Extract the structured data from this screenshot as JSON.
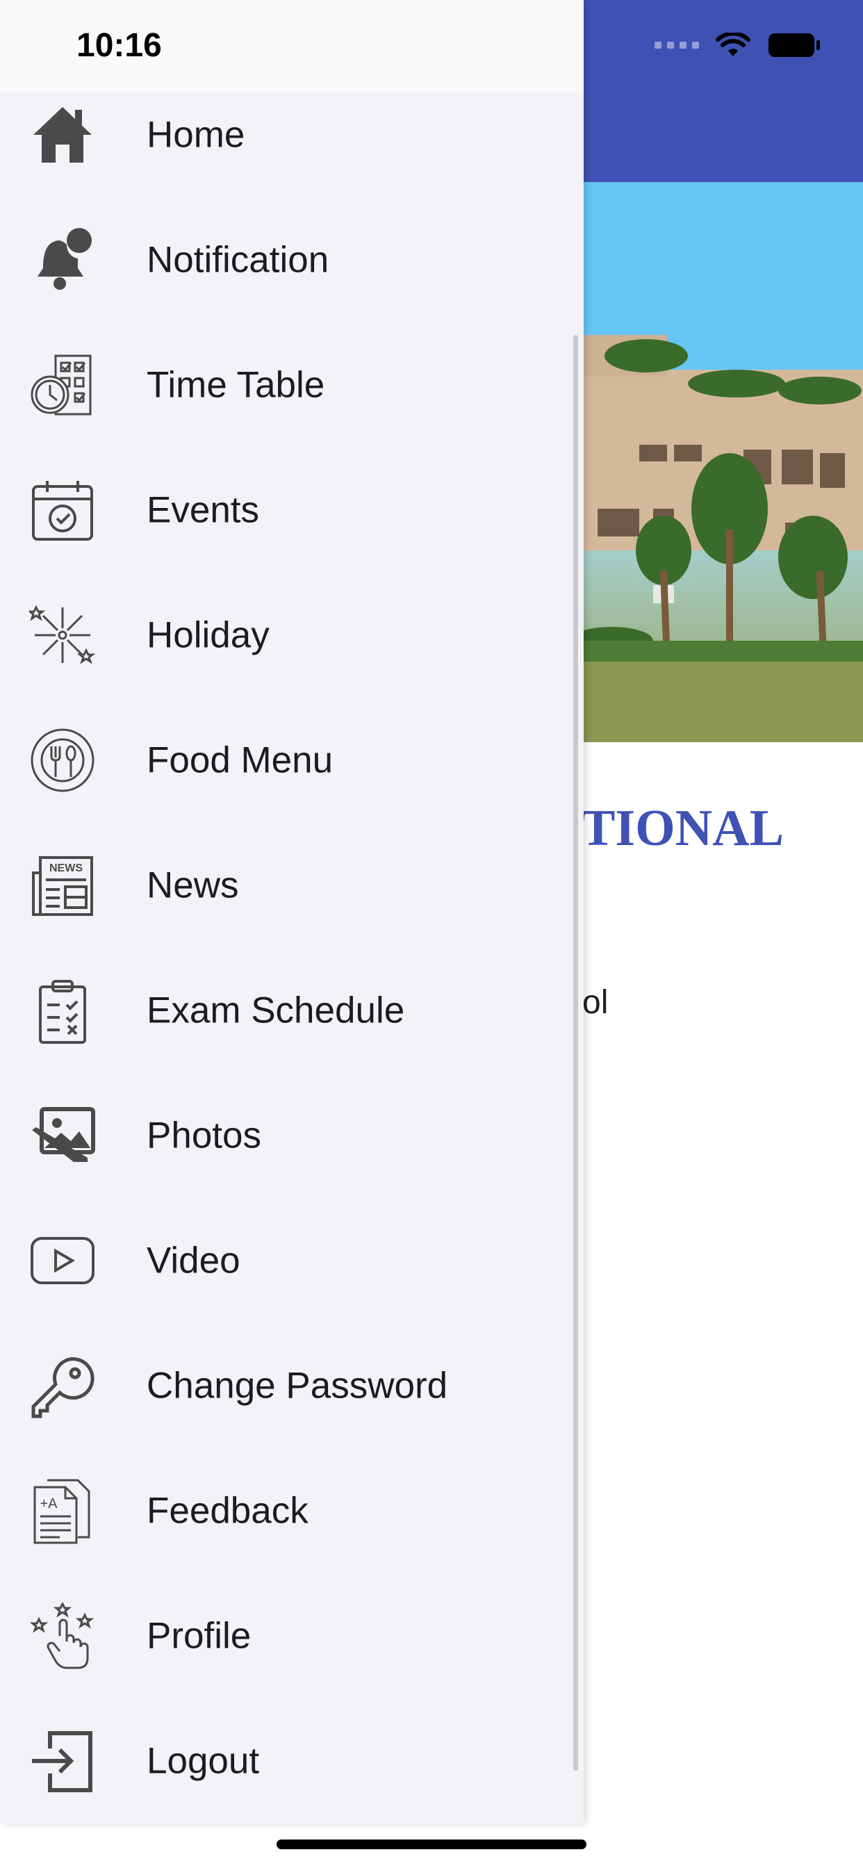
{
  "status_bar": {
    "time": "10:16"
  },
  "background": {
    "title_fragment": "TIONAL",
    "subtitle_fragment": "ol",
    "accent_color": "#3f51b5"
  },
  "drawer": {
    "items": [
      {
        "label": "Home",
        "icon": "home-icon"
      },
      {
        "label": "Notification",
        "icon": "bell-icon"
      },
      {
        "label": "Time Table",
        "icon": "timetable-icon"
      },
      {
        "label": "Events",
        "icon": "calendar-icon"
      },
      {
        "label": "Holiday",
        "icon": "fireworks-icon"
      },
      {
        "label": "Food Menu",
        "icon": "food-icon"
      },
      {
        "label": "News",
        "icon": "newspaper-icon"
      },
      {
        "label": "Exam Schedule",
        "icon": "clipboard-icon"
      },
      {
        "label": "Photos",
        "icon": "photos-icon"
      },
      {
        "label": "Video",
        "icon": "video-icon"
      },
      {
        "label": "Change Password",
        "icon": "key-icon"
      },
      {
        "label": "Feedback",
        "icon": "feedback-icon"
      },
      {
        "label": "Profile",
        "icon": "profile-icon"
      },
      {
        "label": "Logout",
        "icon": "logout-icon"
      }
    ]
  }
}
